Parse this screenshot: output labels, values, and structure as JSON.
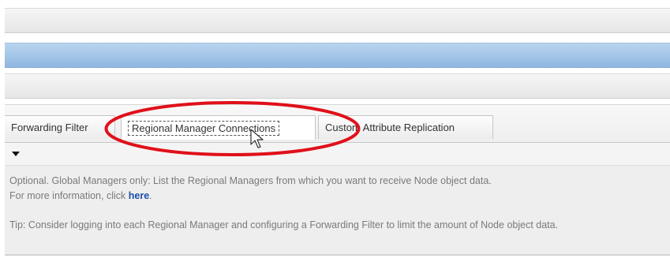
{
  "tabs": [
    {
      "label": "Forwarding Filter",
      "active": false
    },
    {
      "label": "Regional Manager Connections",
      "active": true
    },
    {
      "label": "Custom Attribute Replication",
      "active": false
    }
  ],
  "description": {
    "line1": "Optional. Global Managers only: List the Regional Managers from which you want to receive Node object data.",
    "line2_prefix": "For more information, click",
    "link_text": "here",
    "line2_suffix": ".",
    "tip": "Tip: Consider logging into each Regional Manager and configuring a Forwarding Filter to limit the amount of Node object data."
  },
  "colors": {
    "highlight_oval": "#e0101a",
    "link": "#1b4fa8",
    "header_blue": "#9cbfe6"
  },
  "icons": {
    "collapse": "caret-down-icon",
    "pointer": "mouse-cursor-icon"
  }
}
